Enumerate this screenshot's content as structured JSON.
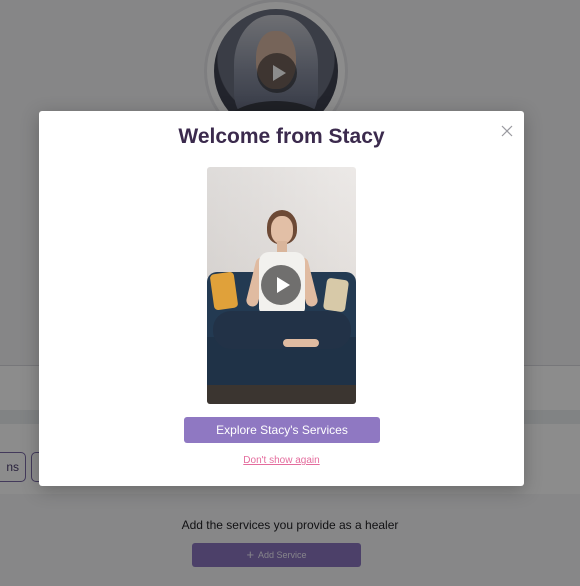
{
  "background": {
    "left_chip_text": "ns",
    "services_prompt": "Add the services you provide as a healer",
    "add_service_label": "Add Service"
  },
  "modal": {
    "title": "Welcome from Stacy",
    "cta_label": "Explore Stacy's Services",
    "dismiss_link": "Don't show again"
  },
  "icons": {
    "close": "close-icon",
    "play": "play-icon",
    "plus": "plus-icon"
  },
  "colors": {
    "title": "#3b2a4d",
    "cta_bg": "#8f78c2",
    "link": "#e46c9d",
    "overlay": "rgba(0,0,0,0.45)"
  }
}
